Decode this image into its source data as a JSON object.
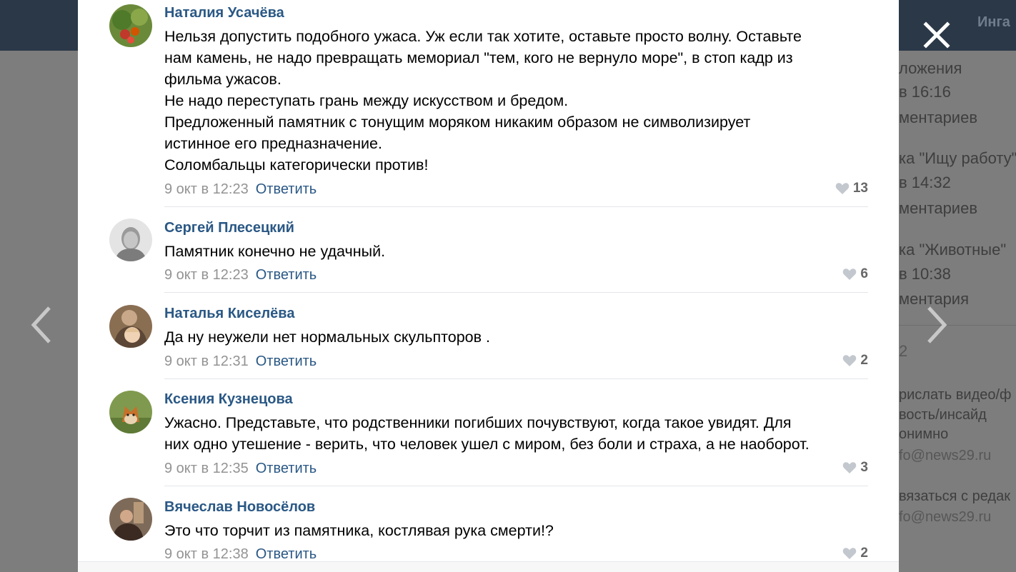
{
  "background": {
    "user_name": "Инга",
    "sidebar_lines": [
      "ложения",
      "в 16:16",
      "ментариев",
      "ка \"Ищу работу\"",
      "в 14:32",
      "ментариев",
      "ка \"Животные\"",
      "в 10:38",
      "ментария",
      "2",
      "рислать видео/ф",
      "вость/инсайд",
      "онимно",
      "fo@news29.ru",
      "вязаться с редак",
      "fo@news29.ru"
    ]
  },
  "viewer": {
    "close_icon": "close-icon",
    "prev_icon": "chevron-left-icon",
    "next_icon": "chevron-right-icon"
  },
  "comments": [
    {
      "author": "Наталия Усачёва",
      "lines": [
        "Нельзя допустить подобного ужаса. Уж если так хотите, оставьте просто волну. Оставьте",
        "нам камень, не надо превращать мемориал \"тем, кого не вернуло море\", в стоп кадр из",
        "фильма ужасов.",
        "Не надо переступать грань между искусством и бредом.",
        "Предложенный памятник с тонущим моряком никаким образом не символизирует",
        "истинное его предназначение.",
        "Соломбальцы категорически против!"
      ],
      "date": "9 окт в 12:23",
      "reply": "Ответить",
      "likes": "13"
    },
    {
      "author": "Сергей Плесецкий",
      "lines": [
        "Памятник конечно не удачный."
      ],
      "date": "9 окт в 12:23",
      "reply": "Ответить",
      "likes": "6"
    },
    {
      "author": "Наталья Киселёва",
      "lines": [
        "Да ну неужели нет нормальных скульпторов ."
      ],
      "date": "9 окт в 12:31",
      "reply": "Ответить",
      "likes": "2"
    },
    {
      "author": "Ксения Кузнецова",
      "lines": [
        "Ужасно. Представьте, что родственники погибших почувствуют, когда такое увидят. Для",
        "них одно утешение - верить, что человек ушел с миром, без боли и страха, а не наоборот."
      ],
      "date": "9 окт в 12:35",
      "reply": "Ответить",
      "likes": "3"
    },
    {
      "author": "Вячеслав Новосёлов",
      "lines": [
        "Это что торчит из памятника, костлявая рука смерти!?"
      ],
      "date": "9 окт в 12:38",
      "reply": "Ответить",
      "likes": "2"
    }
  ]
}
